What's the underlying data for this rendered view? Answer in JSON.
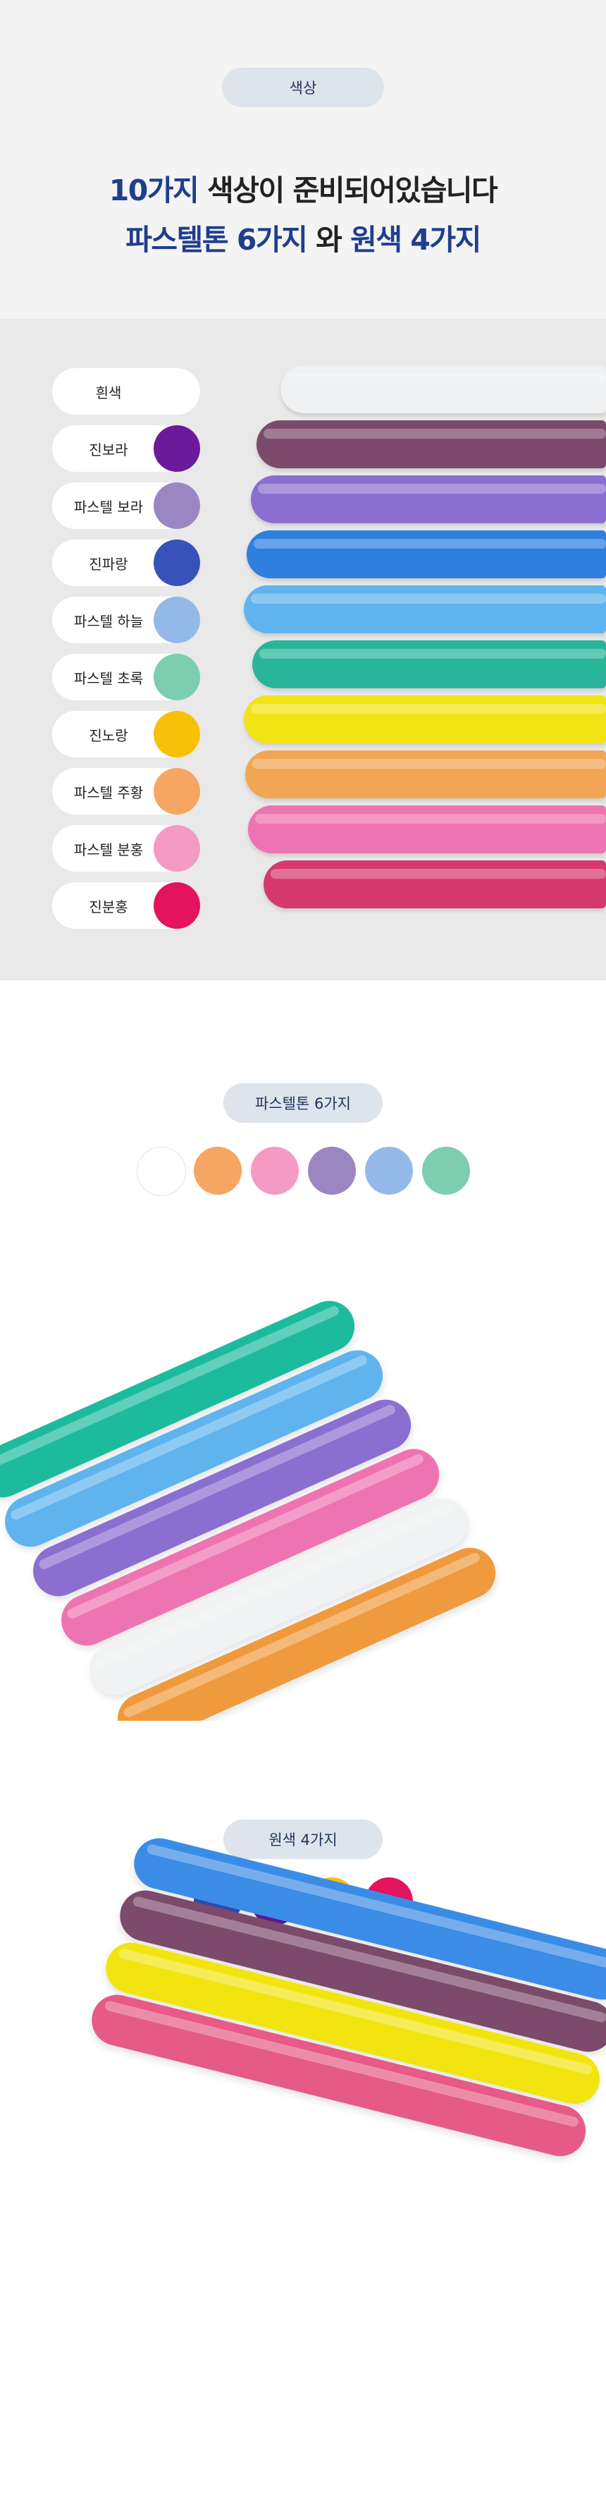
{
  "header": {
    "badge": "색상",
    "line1_accent": "10가지",
    "line1_rest": " 색상이 준비되어있습니다",
    "line2_accent1": "파스텔톤 6가지",
    "line2_mid": " 와 ",
    "line2_accent2": "원색 4가지"
  },
  "color_list": [
    {
      "name": "흰색",
      "color": "#ffffff"
    },
    {
      "name": "진보라",
      "color": "#6a1a9a"
    },
    {
      "name": "파스텔 보라",
      "color": "#9b86c2"
    },
    {
      "name": "진파랑",
      "color": "#3752b8"
    },
    {
      "name": "파스텔 하늘",
      "color": "#94b9e8"
    },
    {
      "name": "파스텔 초록",
      "color": "#7dcdb0"
    },
    {
      "name": "진노랑",
      "color": "#f7c10a"
    },
    {
      "name": "파스텔 주황",
      "color": "#f6a663"
    },
    {
      "name": "파스텔 분홍",
      "color": "#f49ac5"
    },
    {
      "name": "진분홍",
      "color": "#e4135e"
    }
  ],
  "rods": [
    {
      "color": "#eef0f1"
    },
    {
      "color": "#7c4a6b"
    },
    {
      "color": "#8a6fd0"
    },
    {
      "color": "#2f7fde"
    },
    {
      "color": "#5fb4ee"
    },
    {
      "color": "#29b59a"
    },
    {
      "color": "#f0e414"
    },
    {
      "color": "#f0a655"
    },
    {
      "color": "#ee74b1"
    },
    {
      "color": "#d6396e"
    }
  ],
  "pastel": {
    "badge": "파스텔톤 6가지",
    "swatches": [
      "#ffffff",
      "#f6a663",
      "#f49ac5",
      "#9b86c2",
      "#94b9e8",
      "#7dcdb0"
    ],
    "tubes": [
      "#1dbb9e",
      "#5fb4ee",
      "#8a6fd0",
      "#ee74b1",
      "#f0f2f3",
      "#f09a3e"
    ]
  },
  "primary": {
    "badge": "원색 4가지",
    "swatches": [
      "#3752b8",
      "#6a1a9a",
      "#f7c10a",
      "#e4135e"
    ],
    "tubes": [
      "#3b8ce6",
      "#7c4a6b",
      "#f2e40f",
      "#e55a86"
    ]
  }
}
